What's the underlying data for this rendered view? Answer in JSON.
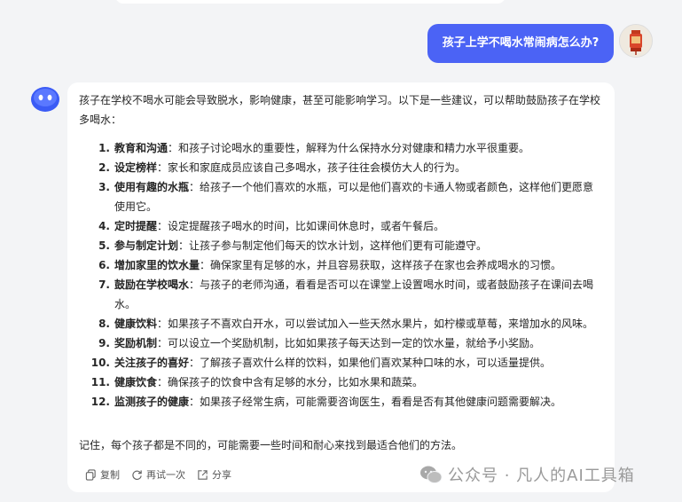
{
  "user_message": "孩子上学不喝水常闹病怎么办?",
  "answer": {
    "intro": "孩子在学校不喝水可能会导致脱水，影响健康，甚至可能影响学习。以下是一些建议，可以帮助鼓励孩子在学校多喝水：",
    "items": [
      {
        "num": "1.",
        "title": "教育和沟通",
        "text": "：和孩子讨论喝水的重要性，解释为什么保持水分对健康和精力水平很重要。"
      },
      {
        "num": "2.",
        "title": "设定榜样",
        "text": "：家长和家庭成员应该自己多喝水，孩子往往会模仿大人的行为。"
      },
      {
        "num": "3.",
        "title": "使用有趣的水瓶",
        "text": "：给孩子一个他们喜欢的水瓶，可以是他们喜欢的卡通人物或者颜色，这样他们更愿意使用它。"
      },
      {
        "num": "4.",
        "title": "定时提醒",
        "text": "：设定提醒孩子喝水的时间，比如课间休息时，或者午餐后。"
      },
      {
        "num": "5.",
        "title": "参与制定计划",
        "text": "：让孩子参与制定他们每天的饮水计划，这样他们更有可能遵守。"
      },
      {
        "num": "6.",
        "title": "增加家里的饮水量",
        "text": "：确保家里有足够的水，并且容易获取，这样孩子在家也会养成喝水的习惯。"
      },
      {
        "num": "7.",
        "title": "鼓励在学校喝水",
        "text": "：与孩子的老师沟通，看看是否可以在课堂上设置喝水时间，或者鼓励孩子在课间去喝水。"
      },
      {
        "num": "8.",
        "title": "健康饮料",
        "text": "：如果孩子不喜欢白开水，可以尝试加入一些天然水果片，如柠檬或草莓，来增加水的风味。"
      },
      {
        "num": "9.",
        "title": "奖励机制",
        "text": "：可以设立一个奖励机制，比如如果孩子每天达到一定的饮水量，就给予小奖励。"
      },
      {
        "num": "10.",
        "title": "关注孩子的喜好",
        "text": "：了解孩子喜欢什么样的饮料，如果他们喜欢某种口味的水，可以适量提供。"
      },
      {
        "num": "11.",
        "title": "健康饮食",
        "text": "：确保孩子的饮食中含有足够的水分，比如水果和蔬菜。"
      },
      {
        "num": "12.",
        "title": "监测孩子的健康",
        "text": "：如果孩子经常生病，可能需要咨询医生，看看是否有其他健康问题需要解决。"
      }
    ],
    "outro": "记住，每个孩子都是不同的，可能需要一些时间和耐心来找到最适合他们的方法。"
  },
  "actions": {
    "copy": "复制",
    "retry": "再试一次",
    "share": "分享"
  },
  "watermark": "公众号 · 凡人的AI工具箱",
  "colors": {
    "user_bubble": "#4b63f5",
    "bot_avatar": "#3b5bf5",
    "background": "#f3f4f6"
  }
}
